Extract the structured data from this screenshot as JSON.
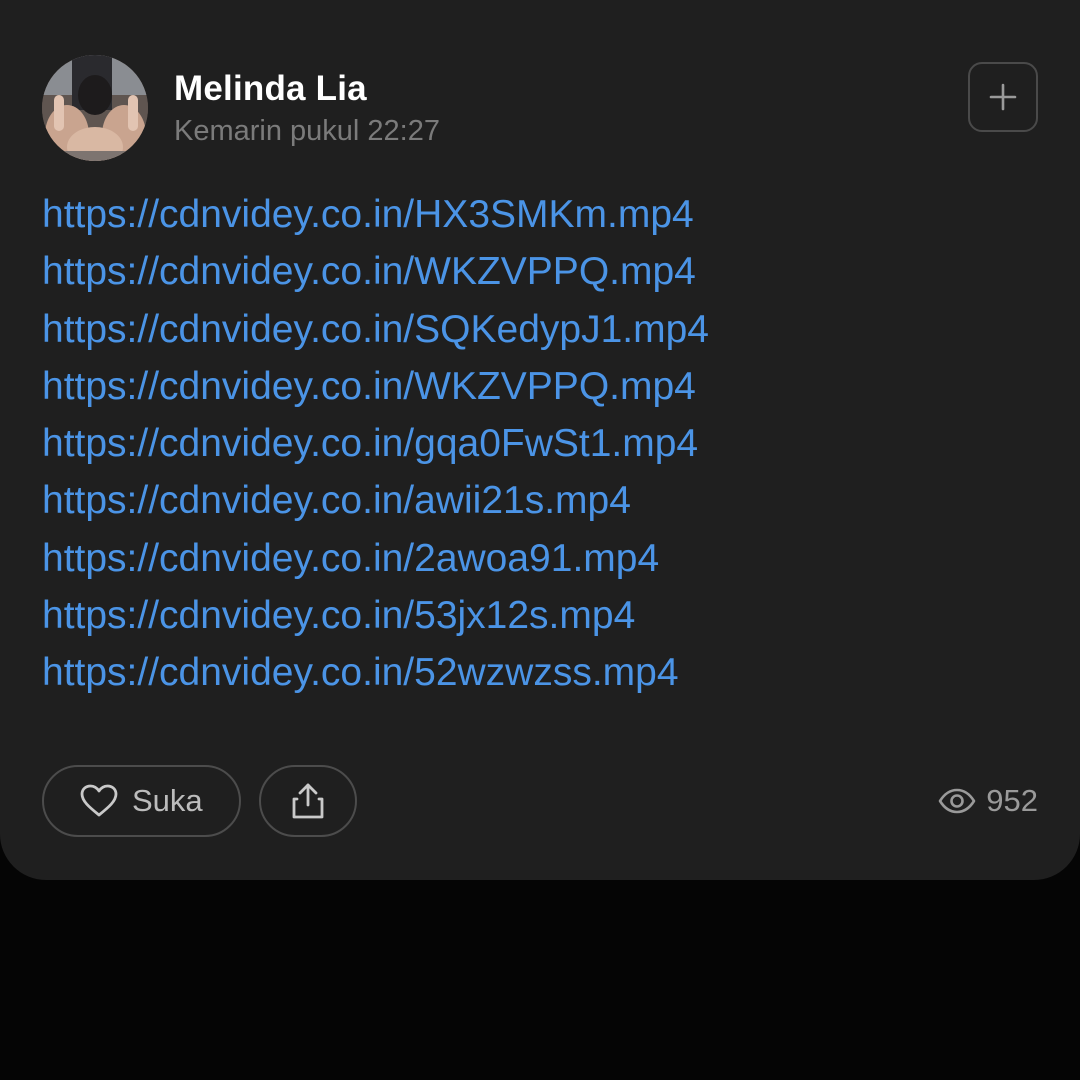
{
  "post": {
    "author_name": "Melinda Lia",
    "timestamp": "Kemarin pukul 22:27",
    "links": [
      "https://cdnvidey.co.in/HX3SMKm.mp4",
      "https://cdnvidey.co.in/WKZVPPQ.mp4",
      "https://cdnvidey.co.in/SQKedypJ1.mp4",
      "https://cdnvidey.co.in/WKZVPPQ.mp4",
      "https://cdnvidey.co.in/gqa0FwSt1.mp4",
      "https://cdnvidey.co.in/awii21s.mp4",
      "https://cdnvidey.co.in/2awoa91.mp4",
      "https://cdnvidey.co.in/53jx12s.mp4",
      "https://cdnvidey.co.in/52wzwzss.mp4"
    ]
  },
  "actions": {
    "like_label": "Suka",
    "views_count": "952"
  },
  "icons": {
    "add": "plus-icon",
    "like": "heart-icon",
    "share": "share-icon",
    "views": "eye-icon"
  },
  "colors": {
    "page_background": "#050505",
    "card_background": "#1f1f1f",
    "link": "#4b94e6",
    "author_name": "#ffffff",
    "muted_text": "#7b7b7b",
    "button_border": "#4c4c4c"
  }
}
